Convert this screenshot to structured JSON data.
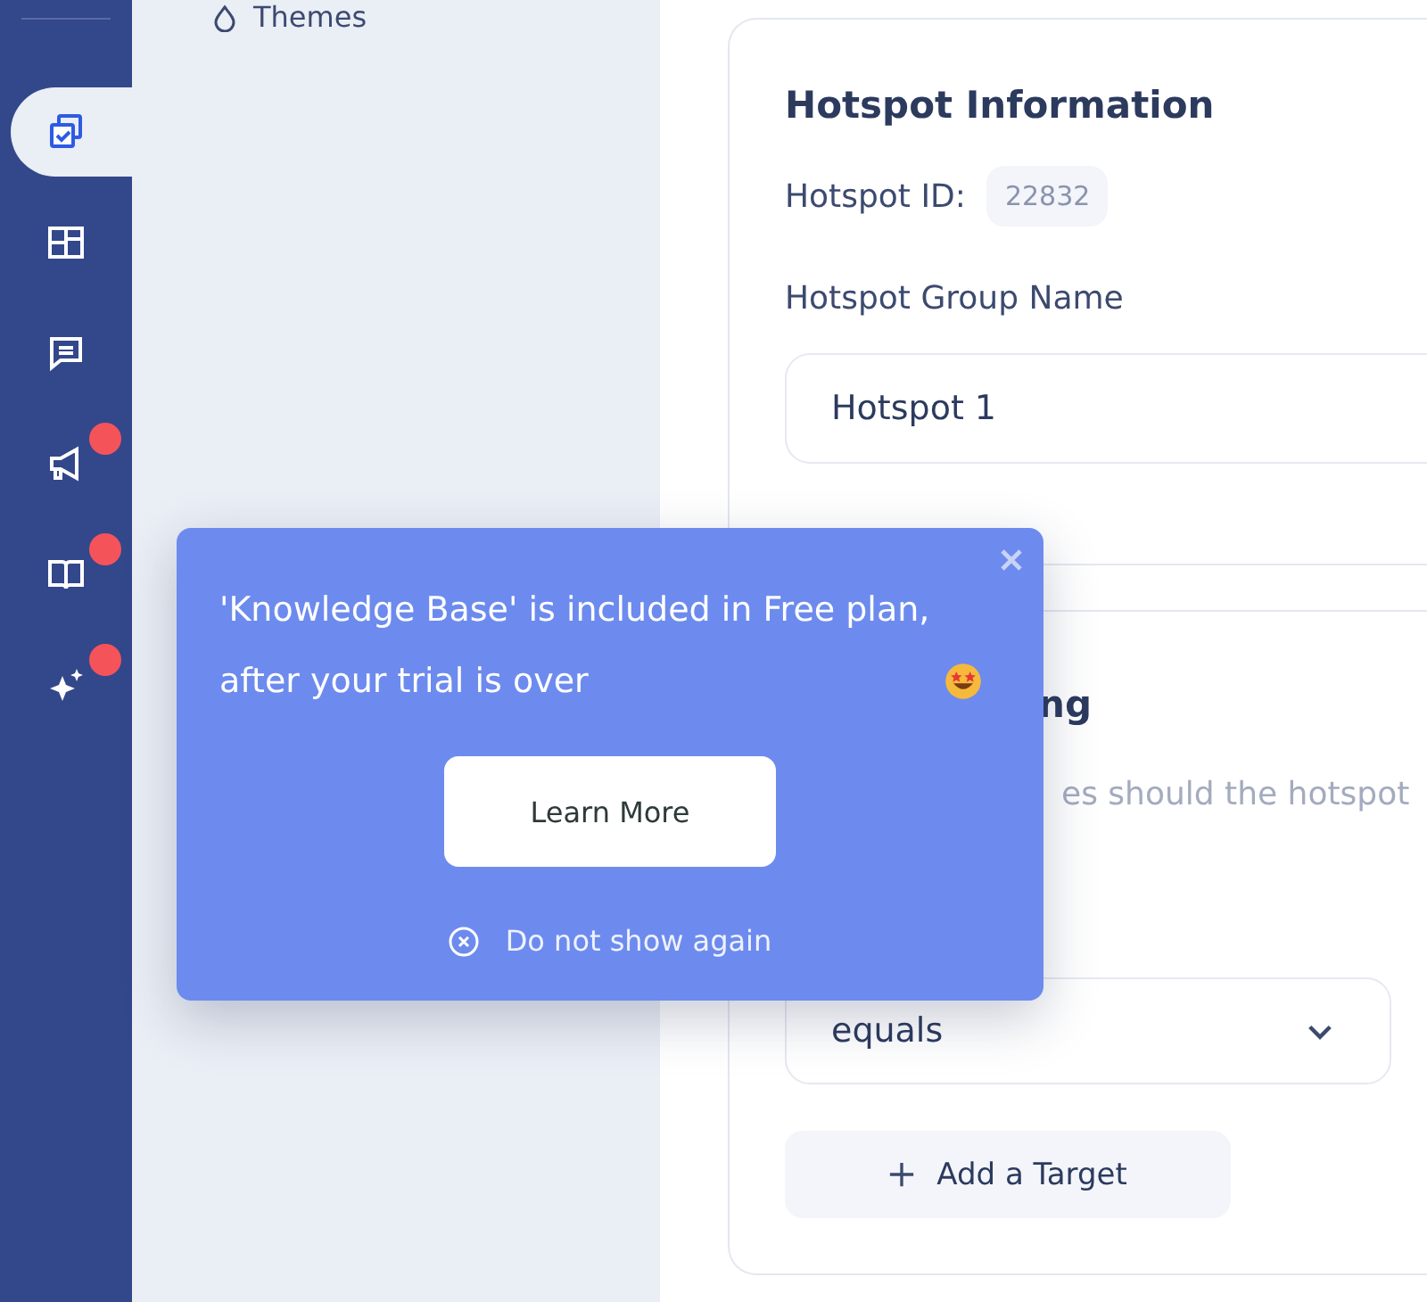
{
  "sidebar": {
    "items": [
      {
        "selected": true,
        "badge": false
      },
      {
        "selected": false,
        "badge": false
      },
      {
        "selected": false,
        "badge": false
      },
      {
        "selected": false,
        "badge": true
      },
      {
        "selected": false,
        "badge": true
      },
      {
        "selected": false,
        "badge": true
      }
    ]
  },
  "subnav": {
    "items": [
      {
        "label": "Themes"
      }
    ]
  },
  "hotspot_information": {
    "title": "Hotspot Information",
    "id_label": "Hotspot ID:",
    "id_value": "22832",
    "group_name_label": "Hotspot Group Name",
    "group_name_value": "Hotspot 1"
  },
  "targeting": {
    "title": "ng",
    "subtitle": "es should the hotspot",
    "operator": "equals",
    "add_button": "Add a Target"
  },
  "popover": {
    "message": "'Knowledge Base' is included in Free plan, after your trial is over",
    "learn_more": "Learn More",
    "dismiss": "Do not show again"
  }
}
